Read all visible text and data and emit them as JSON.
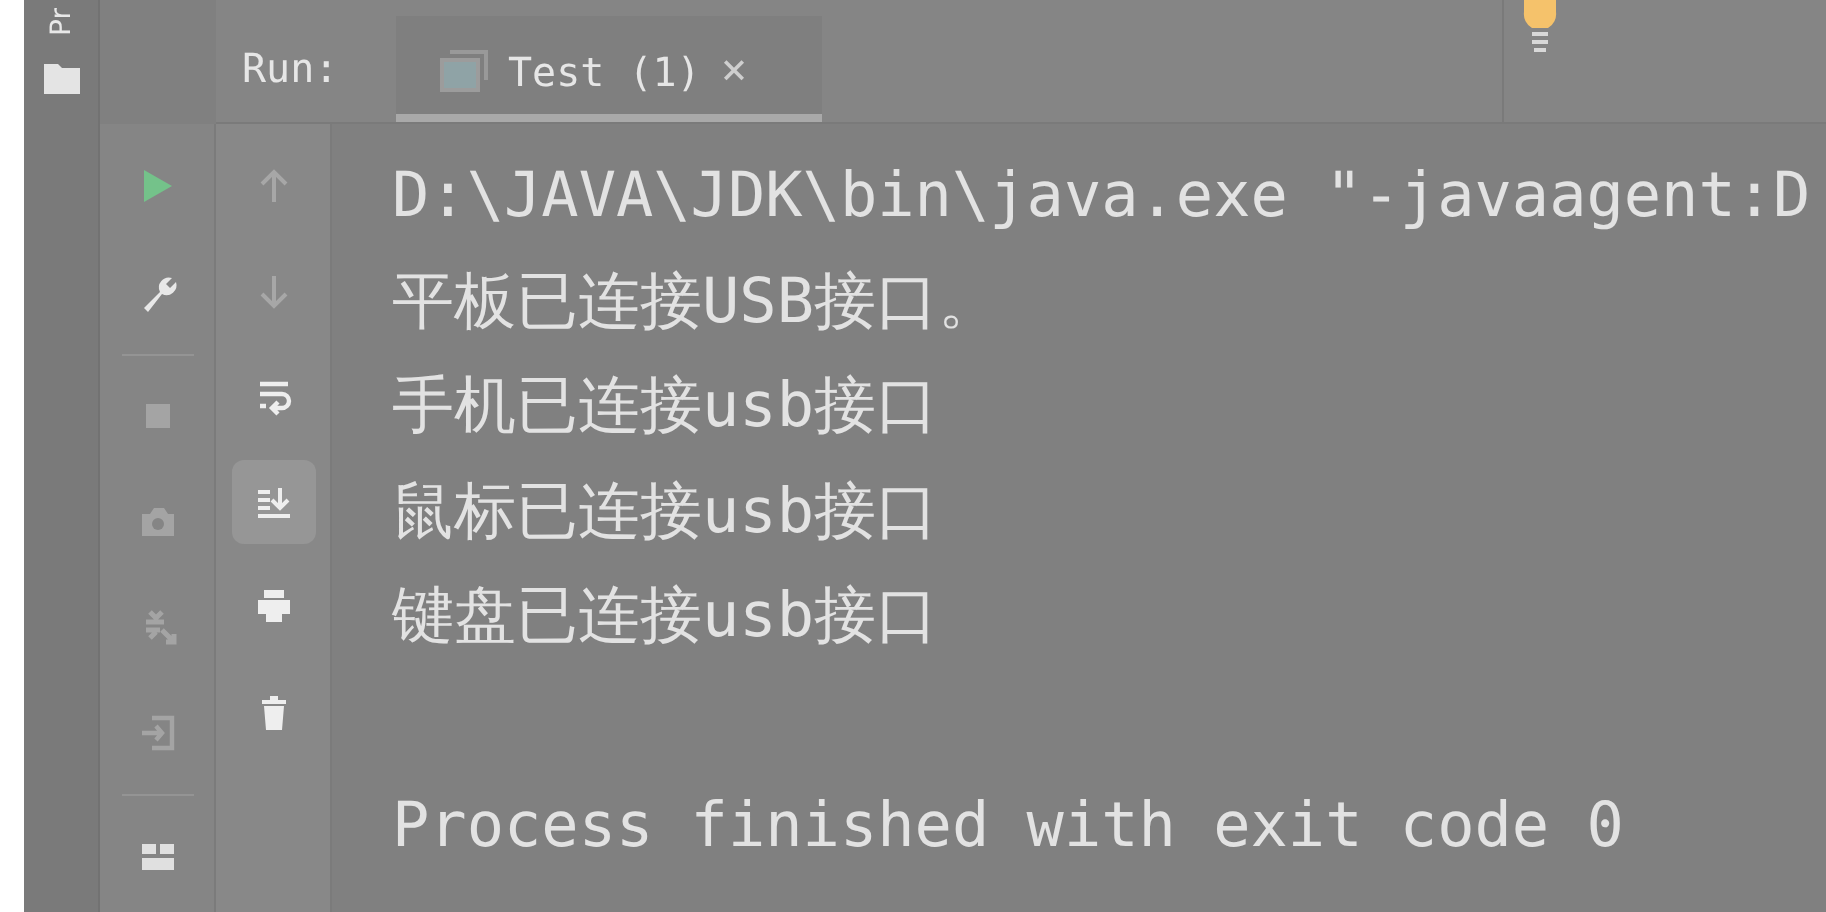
{
  "side_strip": {
    "label": "Pr"
  },
  "run_bar": {
    "label": "Run:",
    "tabs": [
      {
        "label": "Test (1)",
        "selected": true,
        "close": "×"
      }
    ]
  },
  "left_toolbar": [
    {
      "kind": "run",
      "disabled": false
    },
    {
      "kind": "wrench",
      "disabled": false
    },
    {
      "kind": "separator"
    },
    {
      "kind": "stop",
      "disabled": true
    },
    {
      "kind": "camera",
      "disabled": true
    },
    {
      "kind": "debug",
      "disabled": true
    },
    {
      "kind": "exit",
      "disabled": true
    },
    {
      "kind": "separator"
    },
    {
      "kind": "layout",
      "disabled": false
    }
  ],
  "right_toolbar": [
    {
      "kind": "up",
      "disabled": true,
      "selected": false
    },
    {
      "kind": "down",
      "disabled": true,
      "selected": false
    },
    {
      "kind": "wrap",
      "disabled": false,
      "selected": false
    },
    {
      "kind": "scroll-end",
      "disabled": false,
      "selected": true
    },
    {
      "kind": "print",
      "disabled": false,
      "selected": false
    },
    {
      "kind": "trash",
      "disabled": false,
      "selected": false
    }
  ],
  "console": {
    "lines": [
      "D:\\JAVA\\JDK\\bin\\java.exe \"-javaagent:D",
      "平板已连接USB接口。",
      "手机已连接usb接口",
      "鼠标已连接usb接口",
      "键盘已连接usb接口"
    ],
    "exit_message": "Process finished with exit code 0"
  }
}
